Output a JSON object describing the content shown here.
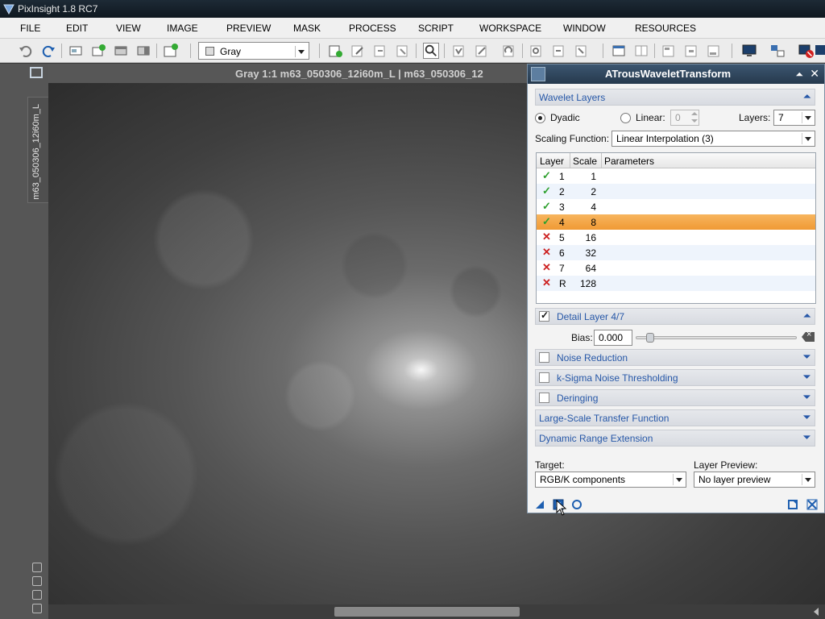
{
  "window": {
    "title": "PixInsight 1.8 RC7"
  },
  "menu": [
    "FILE",
    "EDIT",
    "VIEW",
    "IMAGE",
    "PREVIEW",
    "MASK",
    "PROCESS",
    "SCRIPT",
    "WORKSPACE",
    "WINDOW",
    "RESOURCES"
  ],
  "toolbar": {
    "color_mode": "Gray"
  },
  "image_window": {
    "title": "Gray 1:1 m63_050306_12i60m_L | m63_050306_12",
    "tab_label": "m63_050306_12i60m_L"
  },
  "panel": {
    "title": "ATrousWaveletTransform",
    "wavelet_layers": {
      "header": "Wavelet Layers",
      "dyadic_label": "Dyadic",
      "linear_label": "Linear:",
      "linear_value": "0",
      "layers_label": "Layers:",
      "layers_value": "7",
      "scaling_label": "Scaling Function:",
      "scaling_value": "Linear Interpolation (3)"
    },
    "table": {
      "headers": [
        "Layer",
        "Scale",
        "Parameters"
      ],
      "rows": [
        {
          "status": "✓",
          "layer": "1",
          "scale": "1",
          "params": ""
        },
        {
          "status": "✓",
          "layer": "2",
          "scale": "2",
          "params": ""
        },
        {
          "status": "✓",
          "layer": "3",
          "scale": "4",
          "params": ""
        },
        {
          "status": "✓",
          "layer": "4",
          "scale": "8",
          "params": ""
        },
        {
          "status": "✕",
          "layer": "5",
          "scale": "16",
          "params": ""
        },
        {
          "status": "✕",
          "layer": "6",
          "scale": "32",
          "params": ""
        },
        {
          "status": "✕",
          "layer": "7",
          "scale": "64",
          "params": ""
        },
        {
          "status": "✕",
          "layer": "R",
          "scale": "128",
          "params": ""
        }
      ]
    },
    "detail_layer": {
      "header": "Detail Layer 4/7",
      "bias_label": "Bias:",
      "bias_value": "0.000"
    },
    "sections": {
      "noise_reduction": "Noise Reduction",
      "ksigma": "k-Sigma Noise Thresholding",
      "deringing": "Deringing",
      "large_scale": "Large-Scale Transfer Function",
      "dynamic_range": "Dynamic Range Extension"
    },
    "target": {
      "label": "Target:",
      "value": "RGB/K components"
    },
    "layer_preview": {
      "label": "Layer Preview:",
      "value": "No layer preview"
    }
  },
  "colors": {
    "accent": "#2758a8",
    "selected_row": "#f09a34",
    "titlebar": "#26394d"
  }
}
